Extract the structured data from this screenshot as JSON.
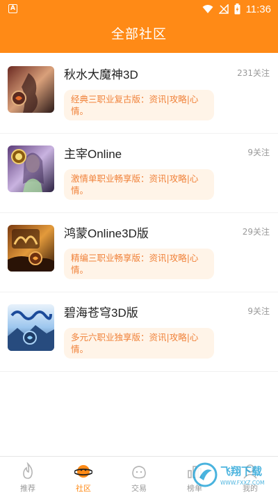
{
  "status_bar": {
    "time": "11:36",
    "left_icon": "A"
  },
  "header": {
    "title": "全部社区"
  },
  "communities": [
    {
      "name": "秋水大魔神3D",
      "follow": "231关注",
      "desc": "经典三职业复古版：资讯|攻略|心情。",
      "thumb_colors": [
        "#6b2a22",
        "#d9a07a",
        "#2c1a18"
      ]
    },
    {
      "name": "主宰Online",
      "follow": "9关注",
      "desc": "激情单职业畅享版：资讯|攻略|心情。",
      "thumb_colors": [
        "#5b3b78",
        "#c9b3e0",
        "#2a2040"
      ]
    },
    {
      "name": "鸿蒙Online3D版",
      "follow": "29关注",
      "desc": "精编三职业畅享版：资讯|攻略|心情。",
      "thumb_colors": [
        "#7a3a10",
        "#e39a3b",
        "#2e1405"
      ]
    },
    {
      "name": "碧海苍穹3D版",
      "follow": "9关注",
      "desc": "多元六职业独享版：资讯|攻略|心情。",
      "thumb_colors": [
        "#1d3f74",
        "#9cc6ee",
        "#e8f2fb"
      ]
    }
  ],
  "tabs": [
    {
      "label": "推荐",
      "icon": "flame-icon",
      "active": false
    },
    {
      "label": "社区",
      "icon": "planet-icon",
      "active": true
    },
    {
      "label": "交易",
      "icon": "bag-icon",
      "active": false
    },
    {
      "label": "榜单",
      "icon": "chart-icon",
      "active": false
    },
    {
      "label": "我的",
      "icon": "user-icon",
      "active": false
    }
  ],
  "watermark": {
    "text": "飞翔下载",
    "url": "WWW.FXXZ.COM"
  },
  "colors": {
    "accent": "#ff8a16",
    "desc_bg": "#fff4e8",
    "desc_text": "#f0823a"
  }
}
